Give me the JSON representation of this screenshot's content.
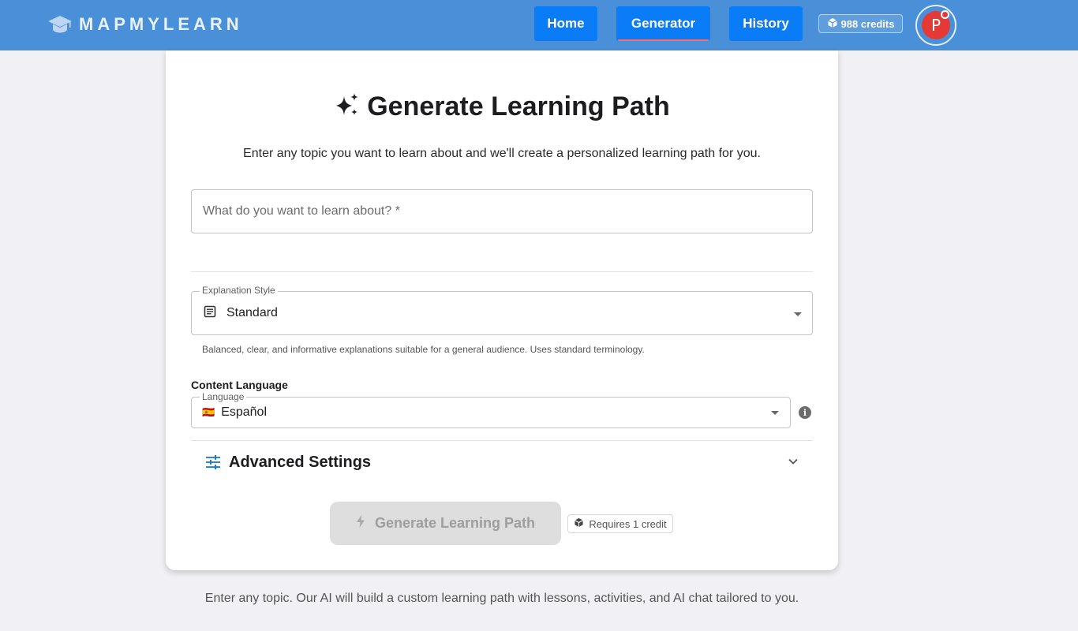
{
  "header": {
    "brand": "MAPMYLEARN",
    "nav": [
      {
        "label": "Home"
      },
      {
        "label": "Generator",
        "active": true
      },
      {
        "label": "History"
      }
    ],
    "credits": "988 credits",
    "avatar_initial": "P"
  },
  "card": {
    "title": "Generate Learning Path",
    "subtitle": "Enter any topic you want to learn about and we'll create a personalized learning path for you.",
    "topic": {
      "placeholder": "What do you want to learn about? *",
      "value": ""
    },
    "explanation_style": {
      "label": "Explanation Style",
      "value": "Standard",
      "helper": "Balanced, clear, and informative explanations suitable for a general audience. Uses standard terminology."
    },
    "content_language": {
      "section_label": "Content Language",
      "label": "Language",
      "flag": "🇪🇸",
      "value": "Español"
    },
    "advanced_settings": "Advanced Settings",
    "generate_button": "Generate Learning Path",
    "requires": "Requires 1 credit"
  },
  "footer": "Enter any topic. Our AI will build a custom learning path with lessons, activities, and AI chat tailored to you.",
  "colors": {
    "header_bg": "#4a90d9",
    "nav_button": "#0b7cf7",
    "active_underline": "#ff6b6b",
    "avatar": "#e53935",
    "accent_icon": "#1976d2"
  }
}
